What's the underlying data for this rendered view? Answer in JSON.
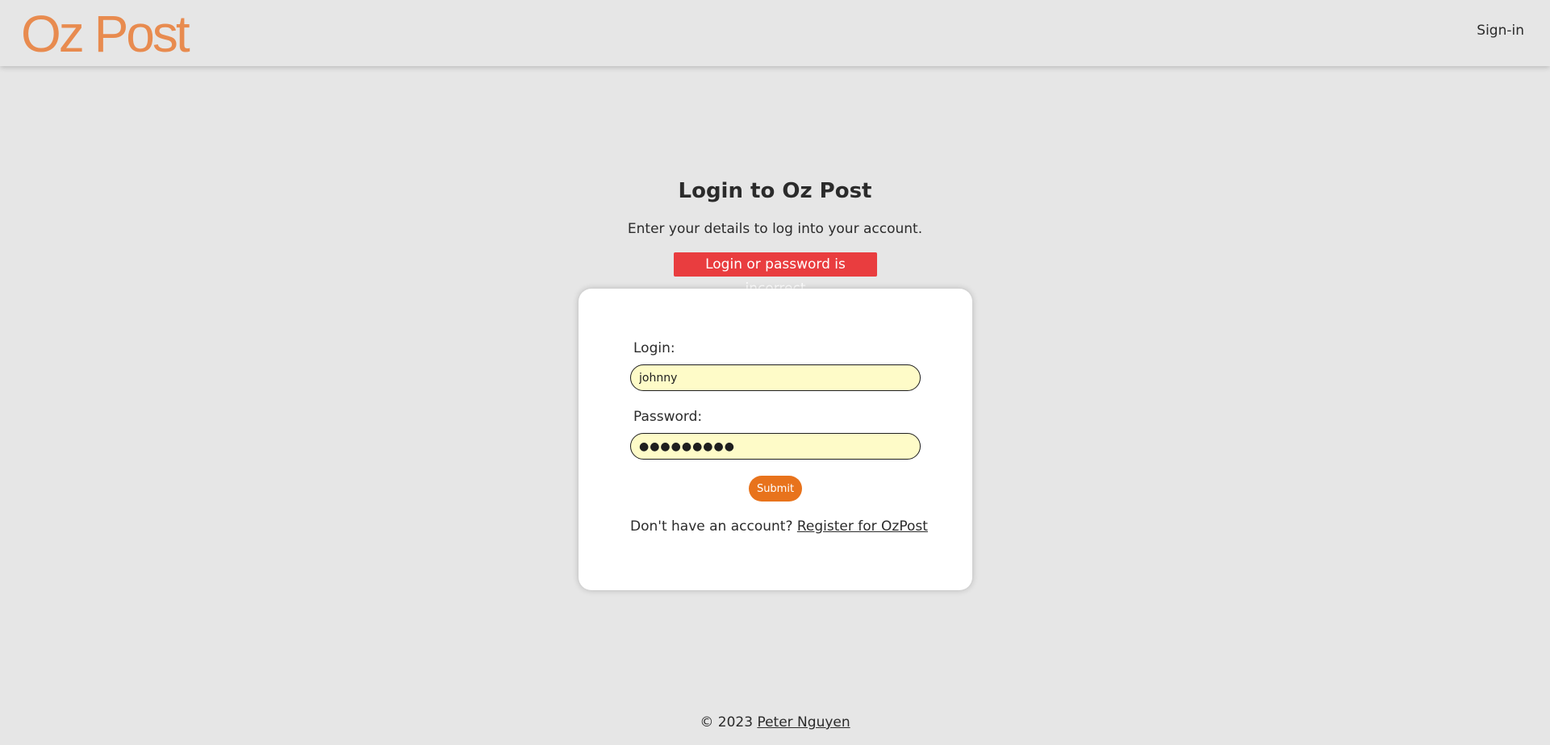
{
  "header": {
    "logo_text": "Oz Post",
    "nav_signin": "Sign-in"
  },
  "main": {
    "title": "Login to Oz Post",
    "subtitle": "Enter your details to log into your account.",
    "error_message": "Login or password is incorrect"
  },
  "form": {
    "login_label": "Login:",
    "login_value": "johnny",
    "password_label": "Password:",
    "password_value": "●●●●●●●●●",
    "submit_label": "Submit",
    "register_prompt": "Don't have an account?",
    "register_link": "Register for OzPost"
  },
  "footer": {
    "copyright": "© 2023",
    "author_link": "Peter Nguyen"
  },
  "colors": {
    "background": "#e6e6e6",
    "logo": "#e88b4f",
    "error": "#e93d3f",
    "submit": "#e8731c",
    "input_fill": "#fefbc8"
  }
}
